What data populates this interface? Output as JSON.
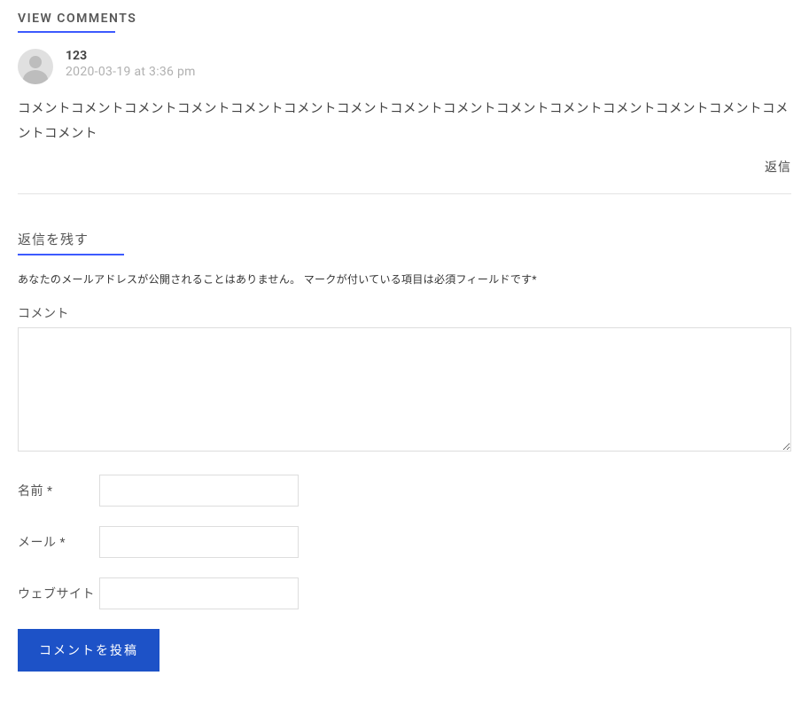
{
  "comments_section": {
    "title": "VIEW COMMENTS"
  },
  "comment": {
    "author": "123",
    "date": "2020-03-19 at 3:36 pm",
    "body": "コメントコメントコメントコメントコメントコメントコメントコメントコメントコメントコメントコメントコメントコメントコメントコメント",
    "reply_label": "返信"
  },
  "reply_form": {
    "title": "返信を残す",
    "notice": "あなたのメールアドレスが公開されることはありません。 マークが付いている項目は必須フィールドです*",
    "comment_label": "コメント",
    "name_label": "名前 *",
    "email_label": "メール *",
    "website_label": "ウェブサイト",
    "submit_label": "コメントを投稿"
  }
}
